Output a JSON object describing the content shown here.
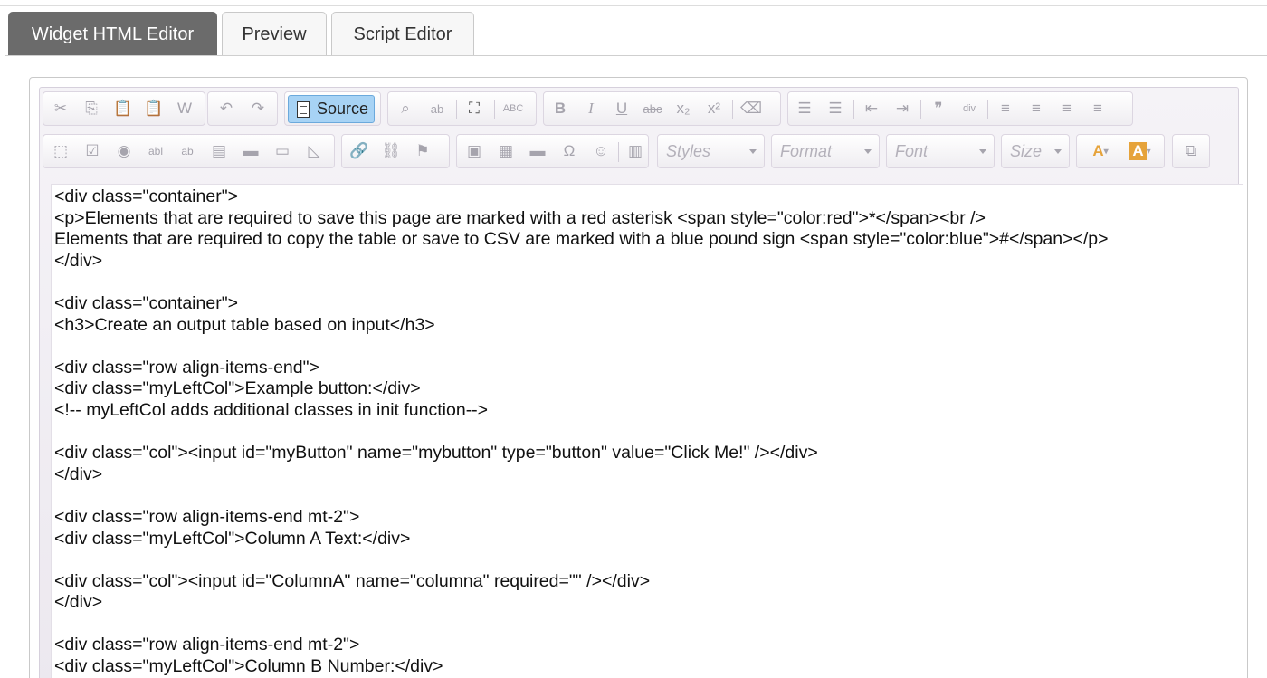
{
  "tabs": [
    {
      "label": "Widget HTML Editor",
      "active": true
    },
    {
      "label": "Preview",
      "active": false
    },
    {
      "label": "Script Editor",
      "active": false
    }
  ],
  "toolbar": {
    "source_label": "Source",
    "combos": {
      "styles": "Styles",
      "format": "Format",
      "font": "Font",
      "size": "Size"
    },
    "icons": {
      "cut": "✂",
      "copy": "⎘",
      "paste": "📋",
      "paste_text": "📋",
      "paste_word": "W",
      "undo": "↶",
      "redo": "↷",
      "find": "⌕",
      "replace": "ab",
      "select_all": "⛶",
      "spellcheck": "ABC",
      "bold": "B",
      "italic": "I",
      "underline": "U",
      "strike": "abc",
      "subscript": "x₂",
      "superscript": "x²",
      "remove_format": "⌫",
      "numbered_list": "☰",
      "bulleted_list": "☰",
      "outdent": "⇤",
      "indent": "⇥",
      "blockquote": "❞",
      "div": "div",
      "align_left": "≡",
      "align_center": "≡",
      "align_right": "≡",
      "justify": "≡",
      "form": "⬚",
      "checkbox": "☑",
      "radio": "◉",
      "textfield": "abl",
      "textarea": "ab",
      "select": "▤",
      "button": "▬",
      "imagebutton": "▭",
      "hiddenfield": "◺",
      "link": "🔗",
      "unlink": "⛓",
      "anchor": "⚑",
      "image": "▣",
      "table": "▦",
      "hr": "▬",
      "special_char": "Ω",
      "smiley": "☺",
      "iframe": "▥",
      "text_color": "A",
      "bg_color": "A",
      "maximize": "⧉"
    }
  },
  "content_lines": [
    "<div class=\"container\">",
    "<p>Elements that are required to save this page are marked with a red asterisk <span style=\"color:red\">*</span><br />",
    "Elements that are required to copy the table or save to CSV are marked with a blue pound sign <span style=\"color:blue\">#</span></p>",
    "</div>",
    "",
    "<div class=\"container\">",
    "<h3>Create an output table based on input</h3>",
    "",
    "<div class=\"row align-items-end\">",
    "<div class=\"myLeftCol\">Example button:</div>",
    "<!-- myLeftCol adds additional classes in init function-->",
    "",
    "<div class=\"col\"><input id=\"myButton\" name=\"mybutton\" type=\"button\" value=\"Click Me!\" /></div>",
    "</div>",
    "",
    "<div class=\"row align-items-end mt-2\">",
    "<div class=\"myLeftCol\">Column A Text:</div>",
    "",
    "<div class=\"col\"><input id=\"ColumnA\" name=\"columna\" required=\"\" /></div>",
    "</div>",
    "",
    "<div class=\"row align-items-end mt-2\">",
    "<div class=\"myLeftCol\">Column B Number:</div>"
  ]
}
